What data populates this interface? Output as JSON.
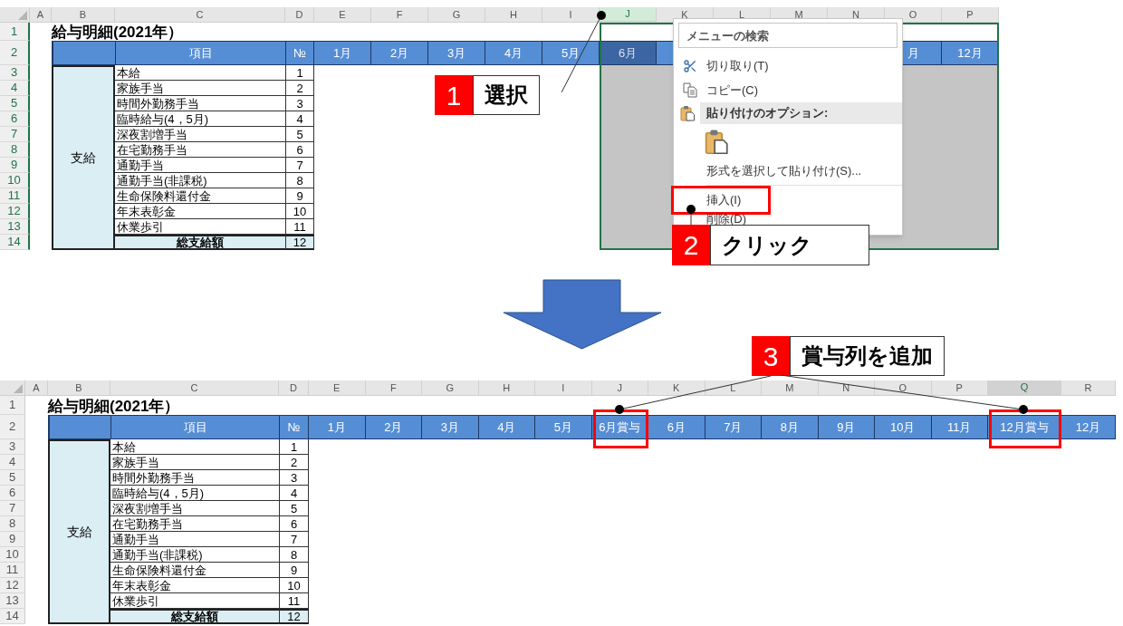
{
  "before": {
    "whole_column_selected": true,
    "columns": [
      {
        "letter": "A",
        "selected": false
      },
      {
        "letter": "B",
        "selected": false
      },
      {
        "letter": "C",
        "selected": false
      },
      {
        "letter": "D",
        "selected": false
      },
      {
        "letter": "E",
        "selected": false
      },
      {
        "letter": "F",
        "selected": false
      },
      {
        "letter": "G",
        "selected": false
      },
      {
        "letter": "H",
        "selected": false
      },
      {
        "letter": "I",
        "selected": false
      },
      {
        "letter": "J",
        "selected": true
      },
      {
        "letter": "K",
        "selected": false
      },
      {
        "letter": "L",
        "selected": false
      },
      {
        "letter": "M",
        "selected": false
      },
      {
        "letter": "N",
        "selected": false
      },
      {
        "letter": "O",
        "selected": false
      },
      {
        "letter": "P",
        "selected": false
      }
    ],
    "rows": [
      "1",
      "2",
      "3",
      "4",
      "5",
      "6",
      "7",
      "8",
      "9",
      "10",
      "11",
      "12",
      "13",
      "14"
    ],
    "title": "給与明細(2021年）",
    "item_header": "項目",
    "no_header": "№",
    "months": [
      {
        "label": "1月",
        "selected": false
      },
      {
        "label": "2月",
        "selected": false
      },
      {
        "label": "3月",
        "selected": false
      },
      {
        "label": "4月",
        "selected": false
      },
      {
        "label": "5月",
        "selected": false
      },
      {
        "label": "6月",
        "selected": true
      },
      {
        "label": "月",
        "selected": false
      },
      {
        "label": "12月",
        "selected": false
      }
    ],
    "group": "支給",
    "items": [
      {
        "name": "本給",
        "no": "1"
      },
      {
        "name": "家族手当",
        "no": "2"
      },
      {
        "name": "時間外勤務手当",
        "no": "3"
      },
      {
        "name": "臨時給与(4，5月)",
        "no": "4"
      },
      {
        "name": "深夜割増手当",
        "no": "5"
      },
      {
        "name": "在宅勤務手当",
        "no": "6"
      },
      {
        "name": "通勤手当",
        "no": "7"
      },
      {
        "name": "通勤手当(非課税)",
        "no": "8"
      },
      {
        "name": "生命保険料還付金",
        "no": "9"
      },
      {
        "name": "年末表彰金",
        "no": "10"
      },
      {
        "name": "休業歩引",
        "no": "11"
      }
    ],
    "total": {
      "name": "総支給額",
      "no": "12"
    },
    "context_menu": {
      "search_placeholder": "メニューの検索",
      "items": [
        {
          "kind": "cut",
          "label": "切り取り(T)",
          "highlighted": false
        },
        {
          "kind": "copy",
          "label": "コピー(C)",
          "highlighted": false
        },
        {
          "kind": "heading",
          "label": "貼り付けのオプション:"
        },
        {
          "kind": "paste_button"
        },
        {
          "kind": "command",
          "label": "形式を選択して貼り付け(S)...",
          "highlighted": false
        },
        {
          "kind": "separator"
        },
        {
          "kind": "command",
          "label": "挿入(I)",
          "highlighted": true
        },
        {
          "kind": "command",
          "label": "削除(D)",
          "highlighted": false
        }
      ]
    },
    "callouts": [
      {
        "number": "1",
        "text": "選択"
      },
      {
        "number": "2",
        "text": "クリック"
      }
    ]
  },
  "after": {
    "whole_column_selected": false,
    "columns": [
      {
        "letter": "A",
        "selected": false
      },
      {
        "letter": "B",
        "selected": false
      },
      {
        "letter": "C",
        "selected": false
      },
      {
        "letter": "D",
        "selected": false
      },
      {
        "letter": "E",
        "selected": false
      },
      {
        "letter": "F",
        "selected": false
      },
      {
        "letter": "G",
        "selected": false
      },
      {
        "letter": "H",
        "selected": false
      },
      {
        "letter": "I",
        "selected": false
      },
      {
        "letter": "J",
        "selected": false
      },
      {
        "letter": "K",
        "selected": false
      },
      {
        "letter": "L",
        "selected": false
      },
      {
        "letter": "M",
        "selected": false
      },
      {
        "letter": "N",
        "selected": false
      },
      {
        "letter": "O",
        "selected": false
      },
      {
        "letter": "P",
        "selected": false
      },
      {
        "letter": "Q",
        "selected": true
      },
      {
        "letter": "R",
        "selected": false
      }
    ],
    "rows": [
      "1",
      "2",
      "3",
      "4",
      "5",
      "6",
      "7",
      "8",
      "9",
      "10",
      "11",
      "12",
      "13",
      "14"
    ],
    "title": "給与明細(2021年）",
    "item_header": "項目",
    "no_header": "№",
    "months": [
      {
        "label": "1月",
        "selected": false,
        "highlighted": false
      },
      {
        "label": "2月",
        "selected": false,
        "highlighted": false
      },
      {
        "label": "3月",
        "selected": false,
        "highlighted": false
      },
      {
        "label": "4月",
        "selected": false,
        "highlighted": false
      },
      {
        "label": "5月",
        "selected": false,
        "highlighted": false
      },
      {
        "label": "6月賞与",
        "selected": false,
        "highlighted": true
      },
      {
        "label": "6月",
        "selected": false,
        "highlighted": false
      },
      {
        "label": "7月",
        "selected": false,
        "highlighted": false
      },
      {
        "label": "8月",
        "selected": false,
        "highlighted": false
      },
      {
        "label": "9月",
        "selected": false,
        "highlighted": false
      },
      {
        "label": "10月",
        "selected": false,
        "highlighted": false
      },
      {
        "label": "11月",
        "selected": false,
        "highlighted": false
      },
      {
        "label": "12月賞与",
        "selected": false,
        "highlighted": true
      },
      {
        "label": "12月",
        "selected": false,
        "highlighted": false
      }
    ],
    "group": "支給",
    "items": [
      {
        "name": "本給",
        "no": "1"
      },
      {
        "name": "家族手当",
        "no": "2"
      },
      {
        "name": "時間外勤務手当",
        "no": "3"
      },
      {
        "name": "臨時給与(4，5月)",
        "no": "4"
      },
      {
        "name": "深夜割増手当",
        "no": "5"
      },
      {
        "name": "在宅勤務手当",
        "no": "6"
      },
      {
        "name": "通勤手当",
        "no": "7"
      },
      {
        "name": "通勤手当(非課税)",
        "no": "8"
      },
      {
        "name": "生命保険料還付金",
        "no": "9"
      },
      {
        "name": "年末表彰金",
        "no": "10"
      },
      {
        "name": "休業歩引",
        "no": "11"
      }
    ],
    "total": {
      "name": "総支給額",
      "no": "12"
    },
    "callouts": [
      {
        "number": "3",
        "text": "賞与列を追加"
      }
    ]
  }
}
